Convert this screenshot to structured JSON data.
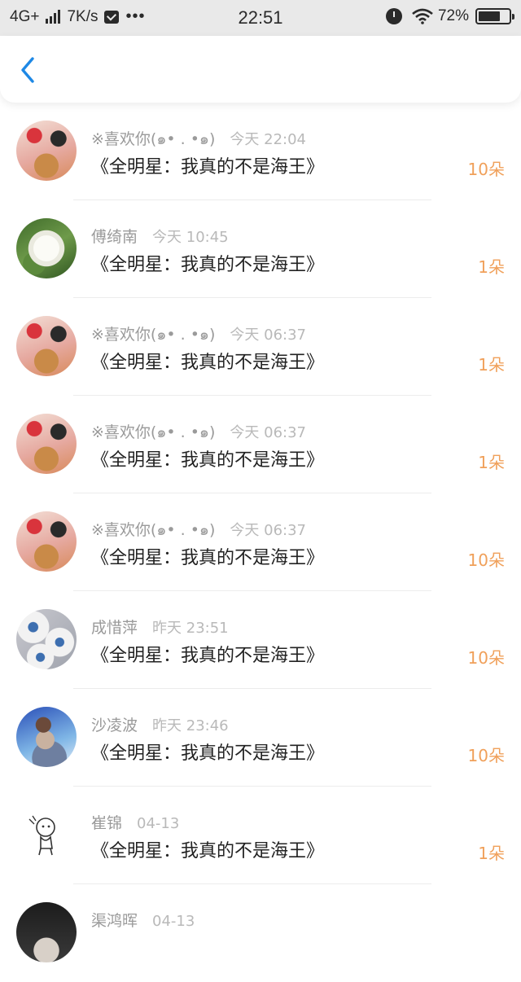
{
  "status_bar": {
    "network": "4G+",
    "speed": "7K/s",
    "dots": "•••",
    "time": "22:51",
    "battery": "72%",
    "battery_level": 0.72
  },
  "nav": {
    "back_icon": "chevron-left-icon",
    "accent": "#1e88e5"
  },
  "items": [
    {
      "name": "※喜欢你(๑• . •๑)",
      "time": "今天 22:04",
      "book": "《全明星：我真的不是海王》",
      "flowers": "10朵",
      "avatar": "anime-couple-avatar"
    },
    {
      "name": "傅绮南",
      "time": "今天 10:45",
      "book": "《全明星：我真的不是海王》",
      "flowers": "1朵",
      "avatar": "white-flower-avatar"
    },
    {
      "name": "※喜欢你(๑• . •๑)",
      "time": "今天 06:37",
      "book": "《全明星：我真的不是海王》",
      "flowers": "1朵",
      "avatar": "anime-couple-avatar"
    },
    {
      "name": "※喜欢你(๑• . •๑)",
      "time": "今天 06:37",
      "book": "《全明星：我真的不是海王》",
      "flowers": "1朵",
      "avatar": "anime-couple-avatar"
    },
    {
      "name": "※喜欢你(๑• . •๑)",
      "time": "今天 06:37",
      "book": "《全明星：我真的不是海王》",
      "flowers": "10朵",
      "avatar": "anime-couple-avatar"
    },
    {
      "name": "成惜萍",
      "time": "昨天 23:51",
      "book": "《全明星：我真的不是海王》",
      "flowers": "10朵",
      "avatar": "daisy-avatar"
    },
    {
      "name": "沙凌波",
      "time": "昨天 23:46",
      "book": "《全明星：我真的不是海王》",
      "flowers": "10朵",
      "avatar": "anime-boy-avatar"
    },
    {
      "name": "崔锦",
      "time": "04-13",
      "book": "《全明星：我真的不是海王》",
      "flowers": "1朵",
      "avatar": "sketch-avatar"
    },
    {
      "name": "渠鸿晖",
      "time": "04-13",
      "book": "",
      "flowers": "",
      "avatar": "dark-portrait-avatar"
    }
  ],
  "colors": {
    "flowers": "#f0a05a",
    "name": "#9a9a9a",
    "time": "#b9b9b9",
    "title": "#222222"
  }
}
